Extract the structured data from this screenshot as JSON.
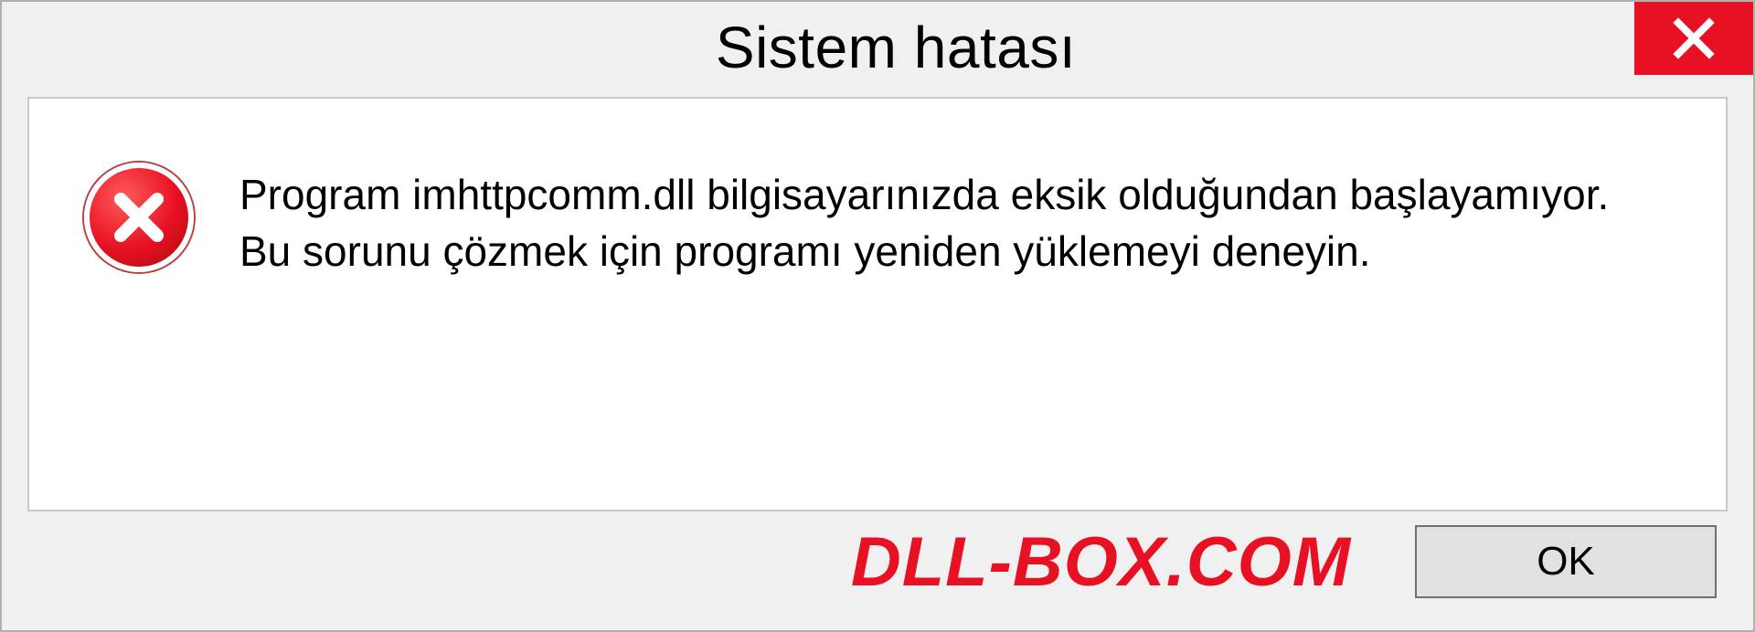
{
  "title": "Sistem hatası",
  "message": "Program imhttpcomm.dll bilgisayarınızda eksik olduğundan başlayamıyor. Bu sorunu çözmek için programı yeniden yüklemeyi deneyin.",
  "watermark": "DLL-BOX.COM",
  "ok_label": "OK",
  "colors": {
    "close_red": "#e81123",
    "panel_bg": "#f0f0f0"
  }
}
